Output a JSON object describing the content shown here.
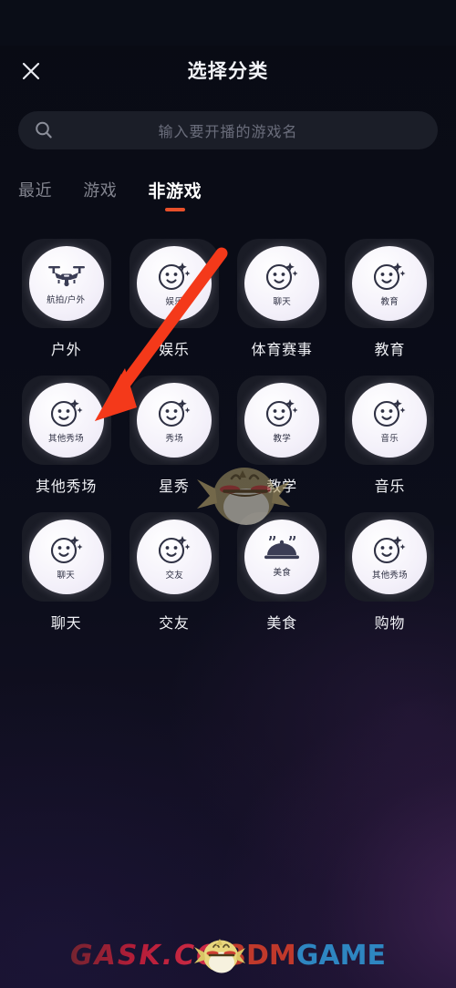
{
  "header": {
    "title": "选择分类",
    "close_icon": "close-icon"
  },
  "search": {
    "icon": "search-icon",
    "placeholder": "输入要开播的游戏名",
    "value": ""
  },
  "tabs": [
    {
      "label": "最近",
      "active": false
    },
    {
      "label": "游戏",
      "active": false
    },
    {
      "label": "非游戏",
      "active": true
    }
  ],
  "active_tab_indicator_color": "#e8502a",
  "categories": [
    {
      "label": "户外",
      "icon": "drone-icon",
      "icon_label": "航拍/户外"
    },
    {
      "label": "娱乐",
      "icon": "smiley-sparkle-icon",
      "icon_label": "娱乐"
    },
    {
      "label": "体育赛事",
      "icon": "smiley-sparkle-icon",
      "icon_label": "聊天"
    },
    {
      "label": "教育",
      "icon": "smiley-sparkle-icon",
      "icon_label": "教育"
    },
    {
      "label": "其他秀场",
      "icon": "smiley-sparkle-icon",
      "icon_label": "其他秀场"
    },
    {
      "label": "星秀",
      "icon": "smiley-sparkle-icon",
      "icon_label": "秀场"
    },
    {
      "label": "教学",
      "icon": "smiley-sparkle-icon",
      "icon_label": "教学"
    },
    {
      "label": "音乐",
      "icon": "smiley-sparkle-icon",
      "icon_label": "音乐"
    },
    {
      "label": "聊天",
      "icon": "smiley-sparkle-icon",
      "icon_label": "聊天"
    },
    {
      "label": "交友",
      "icon": "smiley-sparkle-icon",
      "icon_label": "交友"
    },
    {
      "label": "美食",
      "icon": "food-dome-icon",
      "icon_label": "美食"
    },
    {
      "label": "购物",
      "icon": "smiley-sparkle-icon",
      "icon_label": "其他秀场"
    }
  ],
  "annotation": {
    "arrow_color": "#f4391a",
    "points_to": "其他秀场"
  },
  "watermark": {
    "left_text": "GASK.CC",
    "right_text_a": "3DM",
    "right_text_b": "GAME",
    "mascot": "bird-mascot-icon"
  }
}
